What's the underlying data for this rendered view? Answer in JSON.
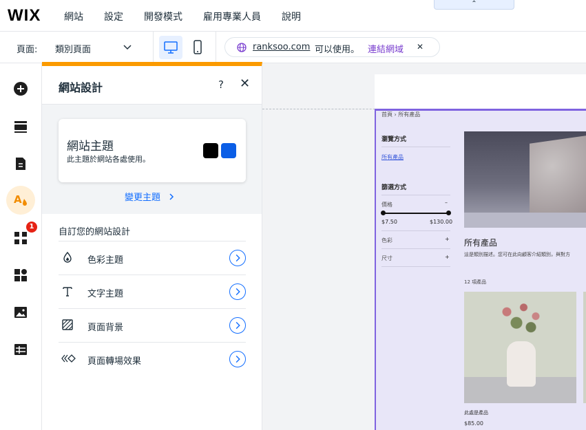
{
  "topbar": {
    "logo": "WIX",
    "menu": [
      "網站",
      "設定",
      "開發模式",
      "雇用專業人員",
      "說明"
    ],
    "collapse_glyph": "⌃"
  },
  "subbar": {
    "page_label": "頁面:",
    "page_select": "類別頁面",
    "domain": "ranksoo.com",
    "domain_status": "可以使用。",
    "connect_link": "連結網域",
    "close_glyph": "✕"
  },
  "rail": {
    "items": [
      "add-icon",
      "sections-icon",
      "pages-icon",
      "design-icon",
      "apps-icon",
      "business-icon",
      "media-icon",
      "cms-icon"
    ],
    "apps_badge": "1"
  },
  "panel": {
    "title": "網站設計",
    "help": "?",
    "close": "✕",
    "theme_title": "網站主題",
    "theme_desc": "此主題於網站各處使用。",
    "swatches": [
      "#000000",
      "#0b5ee6"
    ],
    "change_theme": "變更主題",
    "customize_title": "自訂您的網站設計",
    "options": [
      {
        "label": "色彩主題",
        "icon": "droplet-icon"
      },
      {
        "label": "文字主題",
        "icon": "text-icon"
      },
      {
        "label": "頁面背景",
        "icon": "background-icon"
      },
      {
        "label": "頁面轉場效果",
        "icon": "transition-icon"
      }
    ]
  },
  "site": {
    "breadcrumb_home": "首頁",
    "breadcrumb_current": "所有產品",
    "browse_by": "瀏覽方式",
    "all_products_link": "所有產品",
    "filter_by": "篩選方式",
    "price": "價格",
    "price_min": "$7.50",
    "price_max": "$130.00",
    "color": "色彩",
    "size": "尺寸",
    "category_title": "所有產品",
    "category_desc": "這是類別描述。您可在此向顧客介紹類別，與對方",
    "item_count": "12 項產品",
    "product_name": "此處是產品",
    "product_price": "$85.00"
  }
}
